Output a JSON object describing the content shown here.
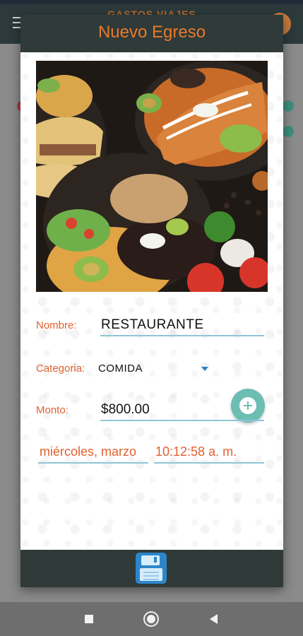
{
  "app": {
    "title": "GASTOS VIAJES"
  },
  "dialog": {
    "title": "Nuevo Egreso",
    "photo_icon": "food-photo",
    "nombre": {
      "label": "Nombre:",
      "value": "RESTAURANTE"
    },
    "categoria": {
      "label": "Categoria:",
      "selected": "COMIDA"
    },
    "monto": {
      "label": "Monto:",
      "value": "$800.00"
    },
    "fecha": "miércoles, marzo",
    "hora": "10:12:58 a. m.",
    "add_icon": "add-circle-icon",
    "save_icon": "save-floppy-icon"
  },
  "colors": {
    "accent": "#e0612f",
    "header": "#2f3a39",
    "fab": "#6cbdb2",
    "save": "#2e86c9",
    "underline": "#8ec6d8"
  }
}
